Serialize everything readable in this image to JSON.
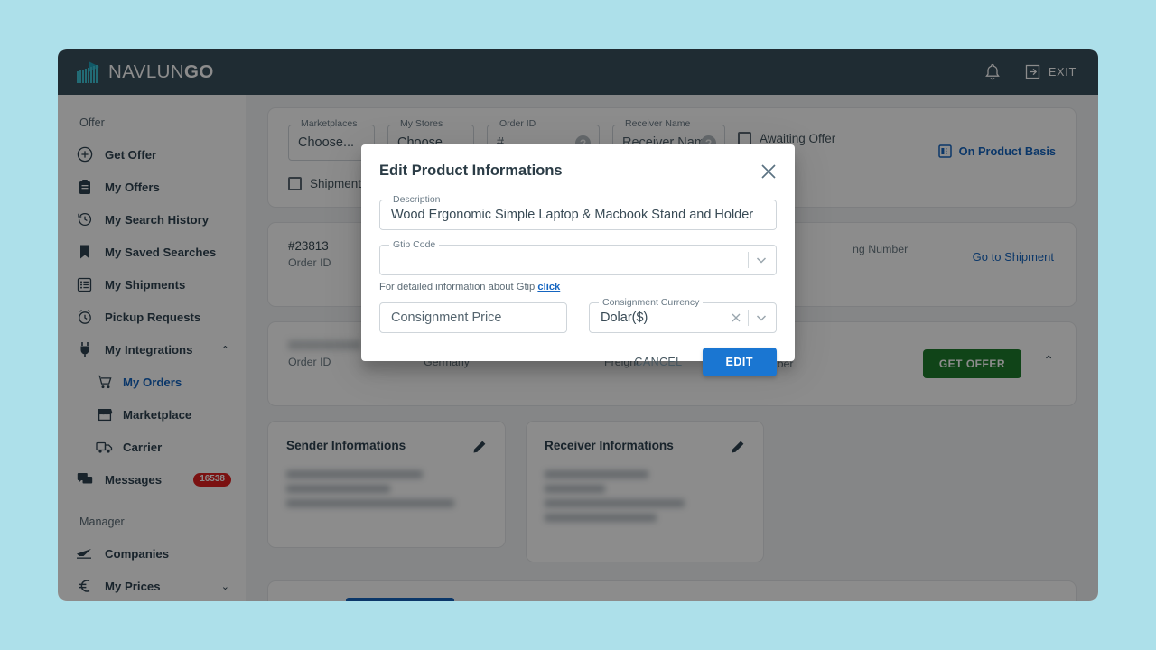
{
  "brand": {
    "name_light": "NAVLUN",
    "name_bold": "GO",
    "accent_color": "#25a3b5",
    "header_bg": "#39505d"
  },
  "topbar": {
    "notifications_icon": "bell-icon",
    "exit_label": "EXIT",
    "exit_icon": "exit-icon"
  },
  "sidebar": {
    "section_offer": "Offer",
    "section_manager": "Manager",
    "items": [
      {
        "label": "Get Offer",
        "icon": "plus-circle-icon"
      },
      {
        "label": "My Offers",
        "icon": "clipboard-icon"
      },
      {
        "label": "My Search History",
        "icon": "history-icon"
      },
      {
        "label": "My Saved Searches",
        "icon": "bookmark-icon"
      },
      {
        "label": "My Shipments",
        "icon": "list-icon"
      },
      {
        "label": "Pickup Requests",
        "icon": "alarm-clock-icon"
      },
      {
        "label": "My Integrations",
        "icon": "plug-icon",
        "chevron": "⌃"
      }
    ],
    "sub_items": [
      {
        "label": "My Orders",
        "icon": "cart-icon",
        "active": true
      },
      {
        "label": "Marketplace",
        "icon": "store-icon"
      },
      {
        "label": "Carrier",
        "icon": "truck-icon"
      }
    ],
    "messages": {
      "label": "Messages",
      "icon": "chat-icon",
      "badge": "16538",
      "badge_color": "#e02020"
    },
    "manager_items": [
      {
        "label": "Companies",
        "icon": "plane-icon"
      },
      {
        "label": "My Prices",
        "icon": "euro-icon",
        "chevron": "⌄"
      }
    ]
  },
  "filters": {
    "marketplaces": {
      "label": "Marketplaces",
      "value": "Choose..."
    },
    "my_stores": {
      "label": "My Stores",
      "value": "Choose..."
    },
    "order_id": {
      "label": "Order ID",
      "value": "#"
    },
    "receiver_name": {
      "label": "Receiver Name",
      "value": "Receiver Name"
    },
    "awaiting_offer": "Awaiting Offer",
    "shipment_checkbox": "Shipment",
    "on_product_basis": "On Product Basis",
    "on_product_basis_icon": "grid-icon",
    "link_color": "#1565c0"
  },
  "shipments": [
    {
      "order_id_value": "#23813",
      "order_id_label": "Order ID",
      "tracking_label": "ng Number",
      "action_link": "Go to Shipment"
    },
    {
      "order_id_label": "Order ID",
      "receiver_name": "Alina Osterkamp",
      "receiver_country": "Germany",
      "freight_value": "-",
      "freight_label": "Freight",
      "tracking_value": "?",
      "tracking_label": "Tracking Number",
      "get_offer": "GET OFFER",
      "get_offer_color": "#1e7c2c",
      "collapse_icon": "chevron-up-icon"
    }
  ],
  "info_cards": {
    "sender_title": "Sender Informations",
    "receiver_title": "Receiver Informations",
    "edit_icon": "pencil-icon"
  },
  "modal": {
    "title": "Edit Product Informations",
    "close_icon": "close-icon",
    "description": {
      "label": "Description",
      "value": "Wood Ergonomic Simple Laptop & Macbook Stand and Holder"
    },
    "gtip_code": {
      "label": "Gtip Code",
      "value": "",
      "chevron_icon": "chevron-down-icon"
    },
    "gtip_note_text": "For detailed information about Gtip",
    "gtip_note_link": "click",
    "consignment_price": {
      "label": "",
      "placeholder": "Consignment Price",
      "value": "Consignment Price"
    },
    "consignment_currency": {
      "label": "Consignment Currency",
      "value": "Dolar($)",
      "clear_icon": "clear-x-icon",
      "chevron_icon": "chevron-down-icon"
    },
    "cancel_label": "CANCEL",
    "edit_label": "EDIT",
    "edit_color": "#1a76d2"
  }
}
